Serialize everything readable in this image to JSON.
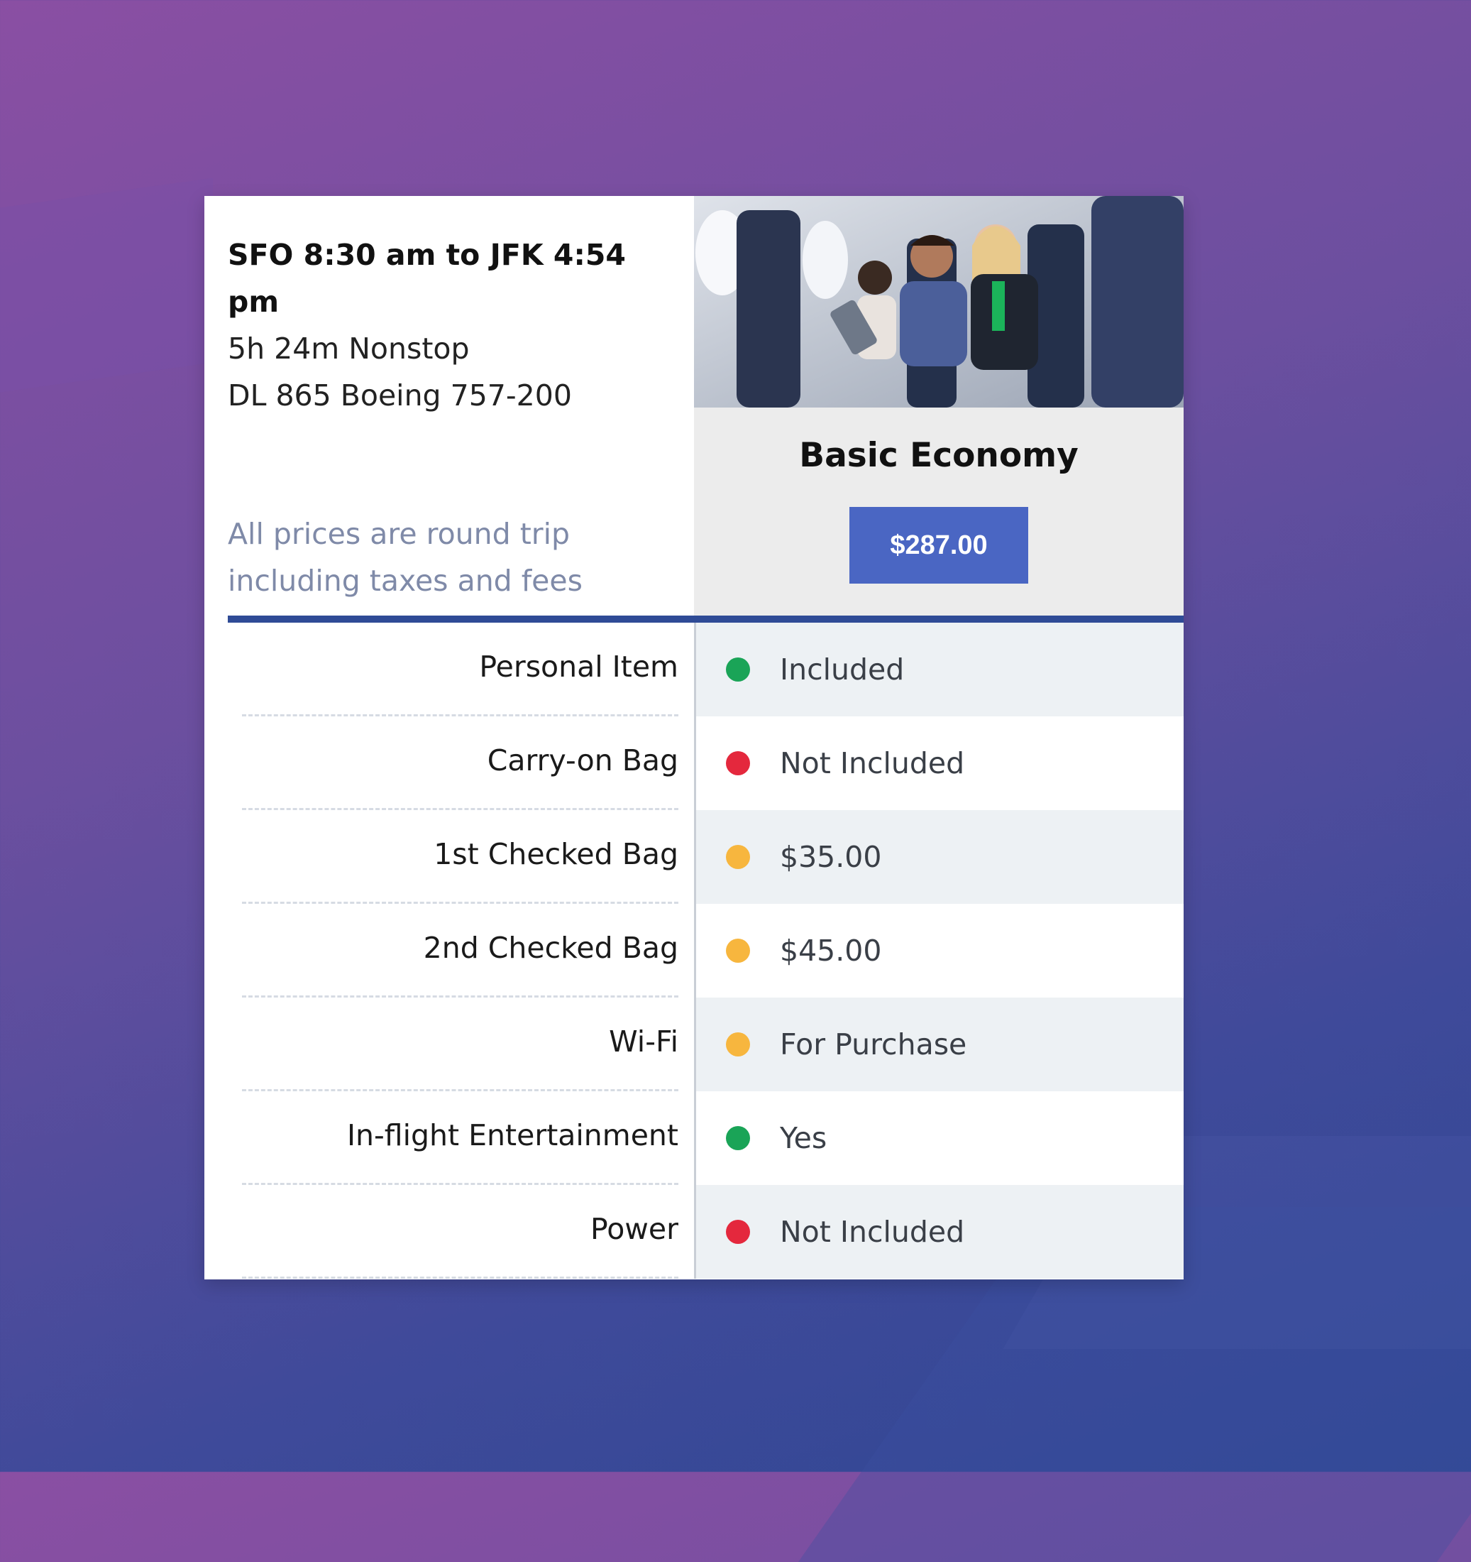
{
  "header": {
    "route": "SFO 8:30 am to JFK 4:54 pm",
    "duration": "5h 24m Nonstop",
    "flight": "DL 865 Boeing 757-200"
  },
  "note": {
    "line1": "All prices are round trip",
    "line2": "including taxes and fees"
  },
  "fare": {
    "name": "Basic Economy",
    "price": "$287.00"
  },
  "colors": {
    "green": "#1aa457",
    "red": "#e4283d",
    "amber": "#f7b63e",
    "accent": "#4a66c3",
    "divider": "#2f4b96"
  },
  "amenities": [
    {
      "label": "Personal Item",
      "value": "Included",
      "status": "green"
    },
    {
      "label": "Carry-on Bag",
      "value": "Not Included",
      "status": "red"
    },
    {
      "label": "1st Checked Bag",
      "value": "$35.00",
      "status": "amber"
    },
    {
      "label": "2nd Checked Bag",
      "value": "$45.00",
      "status": "amber"
    },
    {
      "label": "Wi-Fi",
      "value": "For Purchase",
      "status": "amber"
    },
    {
      "label": "In-flight Entertainment",
      "value": "Yes",
      "status": "green"
    },
    {
      "label": "Power",
      "value": "Not Included",
      "status": "red"
    }
  ]
}
